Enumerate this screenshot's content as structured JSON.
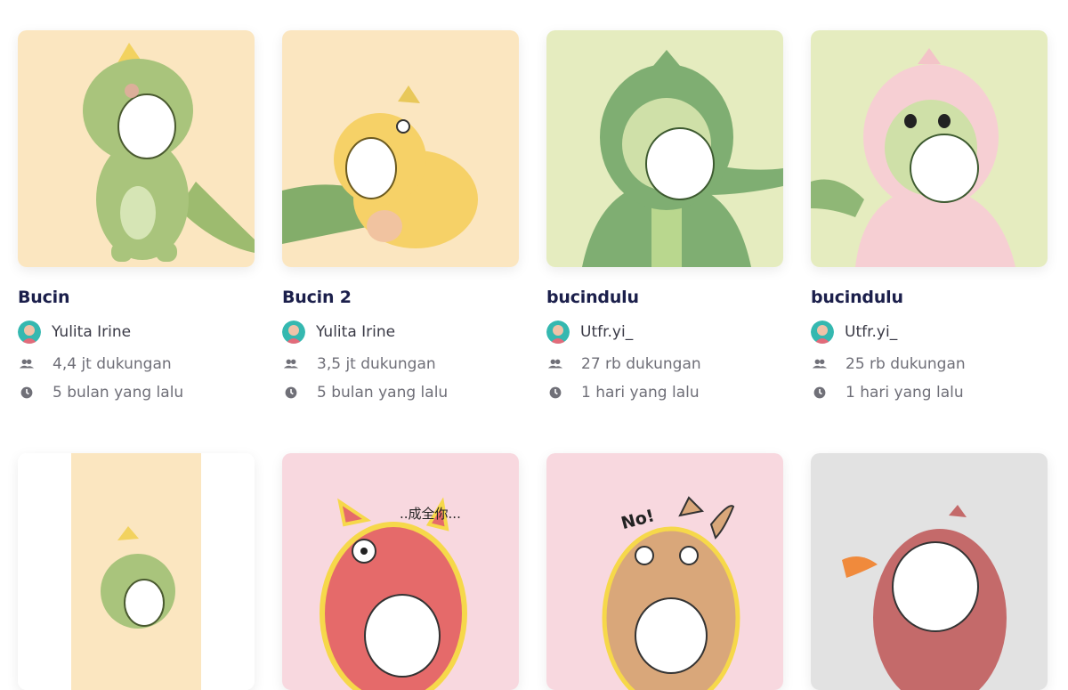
{
  "cards": [
    {
      "title": "Bucin",
      "author": "Yulita Irine",
      "supports": "4,4 jt dukungan",
      "time": "5 bulan yang lalu",
      "bg": "#fbe6c0",
      "theme": "green-dino"
    },
    {
      "title": "Bucin 2",
      "author": "Yulita Irine",
      "supports": "3,5 jt dukungan",
      "time": "5 bulan yang lalu",
      "bg": "#fbe6c0",
      "theme": "yellow-dino"
    },
    {
      "title": "bucindulu",
      "author": "Utfr.yi_",
      "supports": "27 rb dukungan",
      "time": "1 hari yang lalu",
      "bg": "#e5ecbf",
      "theme": "green-hoodie"
    },
    {
      "title": "bucindulu",
      "author": "Utfr.yi_",
      "supports": "25 rb dukungan",
      "time": "1 hari yang lalu",
      "bg": "#e5ecbf",
      "theme": "pink-hoodie"
    },
    {
      "bg": "#ffffff",
      "theme": "green-dino-small"
    },
    {
      "bg": "#f8d8df",
      "theme": "pink-creature",
      "sticker_text": "..成全你..."
    },
    {
      "bg": "#f8d8df",
      "theme": "tan-creature",
      "sticker_text": "No!"
    },
    {
      "bg": "#e2e2e2",
      "theme": "red-dino"
    }
  ],
  "colors": {
    "title": "#1b1f4b",
    "muted": "#6f6f78"
  },
  "icons": {
    "supports": "people-icon",
    "time": "clock-icon"
  }
}
